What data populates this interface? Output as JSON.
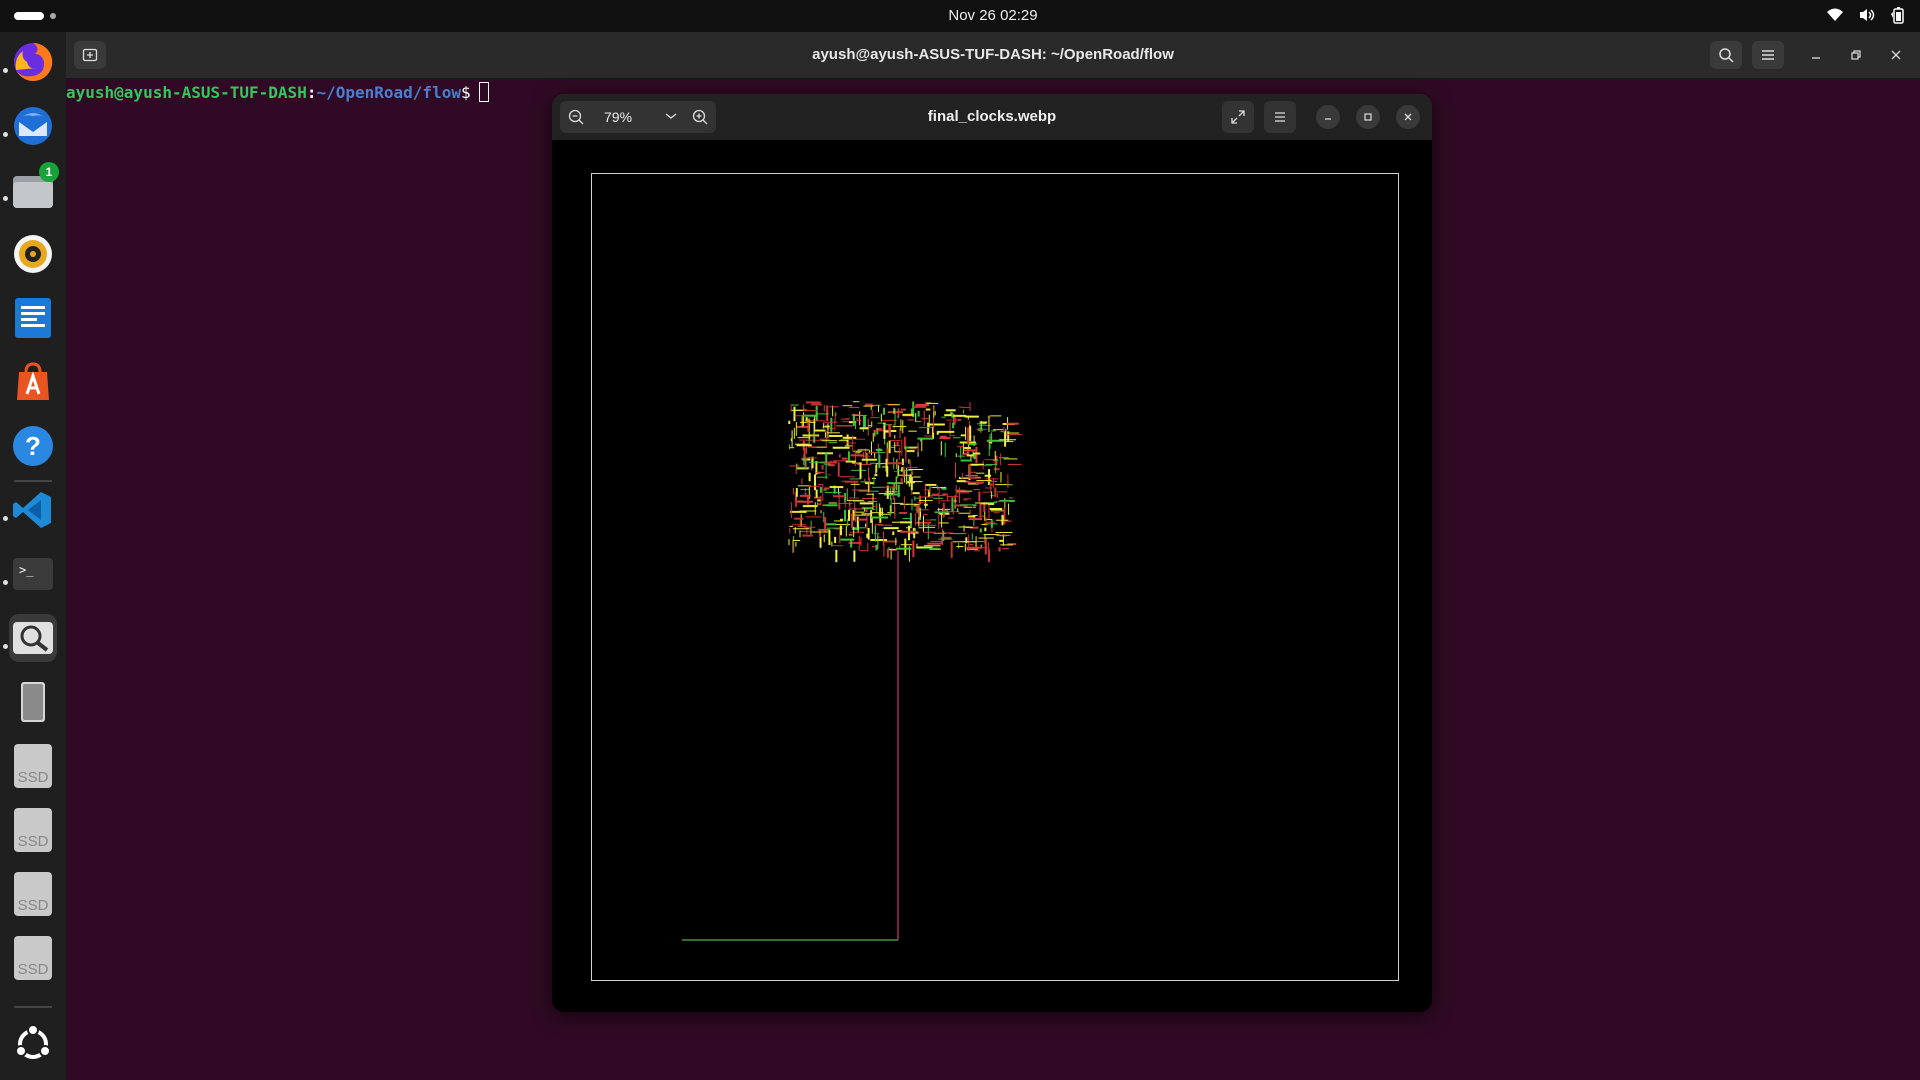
{
  "topbar": {
    "clock": "Nov 26  02:29"
  },
  "terminal": {
    "title": "ayush@ayush-ASUS-TUF-DASH: ~/OpenRoad/flow",
    "prompt_user": "ayush@ayush-ASUS-TUF-DASH",
    "prompt_colon": ":",
    "prompt_path": "~/OpenRoad/flow",
    "prompt_dollar": "$"
  },
  "dock": {
    "items": [
      "firefox-icon",
      "thunderbird-icon",
      "files-icon",
      "rhythmbox-icon",
      "writer-icon",
      "app-center-icon",
      "help-icon",
      "vscode-icon",
      "terminal-icon",
      "image-viewer-icon",
      "drive-icon",
      "ssd-icon",
      "ssd-icon",
      "ssd-icon",
      "ssd-icon",
      "ubuntu-icon"
    ],
    "files_badge": "1",
    "ssd_label": "SSD"
  },
  "viewer": {
    "title": "final_clocks.webp",
    "zoom_level": "79%"
  },
  "colors": {
    "terminal_bg": "#300a24",
    "prompt_user": "#33c75e",
    "prompt_path": "#4a7fd0",
    "clock_tree_trunk": "#c0306a",
    "clock_tree_branch": "#4caf50"
  }
}
